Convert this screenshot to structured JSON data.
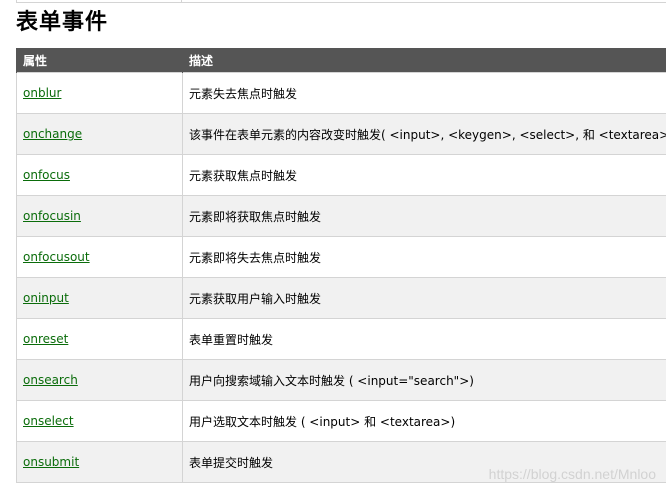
{
  "section": {
    "title": "表单事件"
  },
  "table": {
    "headers": [
      "属性",
      "描述"
    ],
    "rows": [
      {
        "attr": "onblur",
        "desc": "元素失去焦点时触发"
      },
      {
        "attr": "onchange",
        "desc": "该事件在表单元素的内容改变时触发( <input>, <keygen>, <select>, 和 <textarea>)"
      },
      {
        "attr": "onfocus",
        "desc": "元素获取焦点时触发"
      },
      {
        "attr": "onfocusin",
        "desc": "元素即将获取焦点时触发"
      },
      {
        "attr": "onfocusout",
        "desc": "元素即将失去焦点时触发"
      },
      {
        "attr": "oninput",
        "desc": "元素获取用户输入时触发"
      },
      {
        "attr": "onreset",
        "desc": "表单重置时触发"
      },
      {
        "attr": "onsearch",
        "desc": "用户向搜索域输入文本时触发 ( <input=\"search\">)"
      },
      {
        "attr": "onselect",
        "desc": "用户选取文本时触发 ( <input> 和 <textarea>)"
      },
      {
        "attr": "onsubmit",
        "desc": "表单提交时触发"
      }
    ]
  },
  "watermark": "https://blog.csdn.net/Mnloo",
  "colors": {
    "header_bg": "#555555",
    "link": "#0a6c0a",
    "alt_row": "#f1f1f1",
    "border": "#d4d4d4"
  }
}
